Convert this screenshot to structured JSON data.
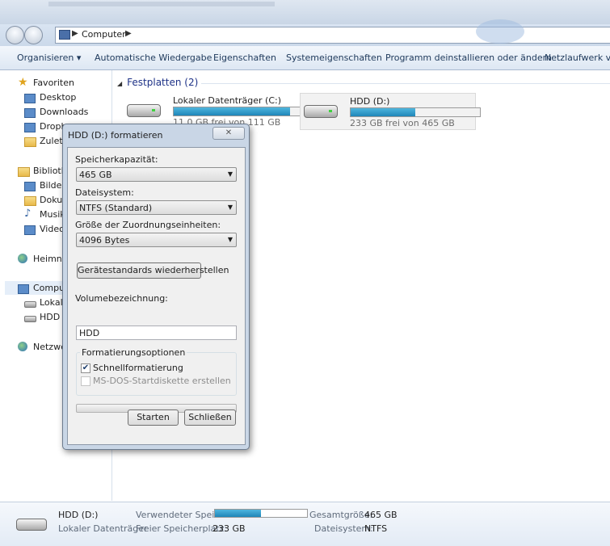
{
  "address": {
    "location": "Computer"
  },
  "toolbar": {
    "organize": "Organisieren",
    "autoplay": "Automatische Wiedergabe",
    "properties": "Eigenschaften",
    "system_properties": "Systemeigenschaften",
    "uninstall": "Programm deinstallieren oder ändern",
    "network_drive": "Netzlaufwerk verb"
  },
  "sidebar": {
    "favorites": "Favoriten",
    "desktop": "Desktop",
    "downloads": "Downloads",
    "dropbox": "Dropb",
    "recent": "Zuletz",
    "libraries": "Biblioth",
    "pictures": "Bilder",
    "documents": "Dokur",
    "music": "Musik",
    "videos": "Videos",
    "homegroup": "Heimne",
    "computer": "Comput",
    "local_disk": "Lokaler",
    "hdd": "HDD (",
    "network": "Netzwer"
  },
  "content": {
    "group_title": "Festplatten (2)",
    "drives": [
      {
        "name": "Lokaler Datenträger (C:)",
        "free_text": "11,0 GB frei von 111 GB",
        "used_fraction": 0.9
      },
      {
        "name": "HDD (D:)",
        "free_text": "233 GB frei von 465 GB",
        "used_fraction": 0.5
      }
    ]
  },
  "status": {
    "name": "HDD (D:)",
    "type": "Lokaler Datenträger",
    "used_label": "Verwendeter Speic...",
    "free_label": "Freier Speicherplatz:",
    "free_value": "233 GB",
    "total_label": "Gesamtgröße:",
    "total_value": "465 GB",
    "fs_label": "Dateisystem:",
    "fs_value": "NTFS",
    "used_fraction": 0.5
  },
  "dialog": {
    "title": "HDD (D:) formatieren",
    "capacity_label": "Speicherkapazität:",
    "capacity_value": "465 GB",
    "fs_label": "Dateisystem:",
    "fs_value": "NTFS (Standard)",
    "alloc_label": "Größe der Zuordnungseinheiten:",
    "alloc_value": "4096 Bytes",
    "restore_button": "Gerätestandards wiederherstellen",
    "volume_label": "Volumebezeichnung:",
    "volume_value": "HDD",
    "options_label": "Formatierungsoptionen",
    "quick_format": "Schnellformatierung",
    "quick_checked": true,
    "msdos": "MS-DOS-Startdiskette erstellen",
    "progress_fraction": 0,
    "start_button": "Starten",
    "close_button": "Schließen"
  }
}
